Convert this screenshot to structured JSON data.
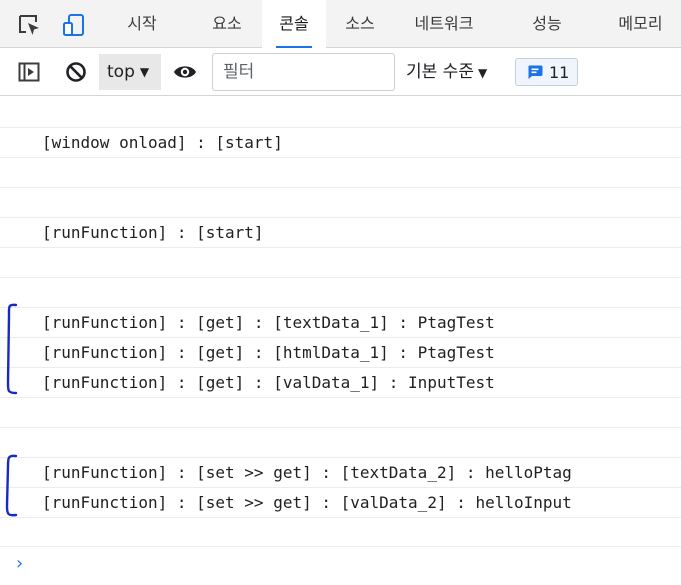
{
  "tabs": {
    "items": [
      "시작",
      "요소",
      "콘솔",
      "소스",
      "네트워크",
      "성능",
      "메모리"
    ],
    "active": "콘솔"
  },
  "toolbar": {
    "context": "top",
    "filter_placeholder": "필터",
    "filter_value": "",
    "level_label": "기본 수준",
    "message_count": "11"
  },
  "console": {
    "lines": [
      "",
      "[window onload] : [start]",
      "",
      "",
      "[runFunction] : [start]",
      "",
      "",
      "[runFunction] : [get] : [textData_1] : PtagTest",
      "[runFunction] : [get] : [htmlData_1] : PtagTest",
      "[runFunction] : [get] : [valData_1] : InputTest",
      "",
      "",
      "[runFunction] : [set >> get] : [textData_2] : helloPtag",
      "[runFunction] : [set >> get] : [valData_2] : helloInput",
      ""
    ],
    "prompt_symbol": "›"
  },
  "colors": {
    "accent": "#1a73e8",
    "annotation": "#1529c7",
    "tabbar_bg": "#f3f3f3"
  },
  "icons": [
    "inspect-element-icon",
    "device-toolbar-icon",
    "sidebar-toggle-icon",
    "clear-console-icon",
    "eye-icon",
    "message-icon",
    "chevron-right-icon"
  ]
}
